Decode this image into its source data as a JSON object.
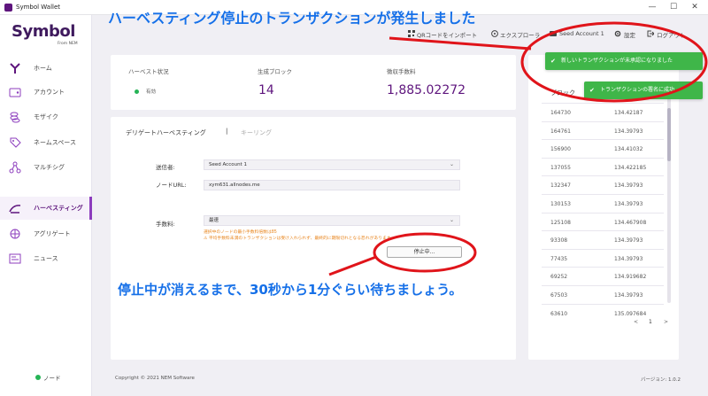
{
  "window": {
    "title": "Symbol Wallet",
    "minimize": "—",
    "maximize": "☐",
    "close": "✕"
  },
  "brand": {
    "logo": "Symbol",
    "sub": "From NEM"
  },
  "nav": [
    {
      "label": "ホーム",
      "icon": "home-icon"
    },
    {
      "label": "アカウント",
      "icon": "account-icon"
    },
    {
      "label": "モザイク",
      "icon": "mosaic-icon"
    },
    {
      "label": "ネームスペース",
      "icon": "namespace-icon"
    },
    {
      "label": "マルチシグ",
      "icon": "multisig-icon"
    },
    {
      "label": "ハーベスティング",
      "icon": "harvesting-icon"
    },
    {
      "label": "アグリゲート",
      "icon": "aggregate-icon"
    },
    {
      "label": "ニュース",
      "icon": "news-icon"
    }
  ],
  "node": {
    "label": "ノード"
  },
  "topbar": {
    "qr": "QRコードをインポート",
    "explorer": "エクスプローラ",
    "account": "Seed Account 1",
    "settings": "設定",
    "logout": "ログアウト"
  },
  "stats": {
    "status_label": "ハーベスト状況",
    "status_value": "有効",
    "blocks_label": "生成ブロック",
    "blocks_value": "14",
    "fees_label": "徴収手数料",
    "fees_value": "1,885.02272"
  },
  "tabs": {
    "delegate": "デリゲートハーベスティング",
    "sep": "|",
    "keyring": "キーリング"
  },
  "form": {
    "sender_label": "送信者:",
    "sender_value": "Seed Account 1",
    "node_label": "ノードURL:",
    "node_value": "xym631.allnodes.me",
    "fee_label": "手数料:",
    "fee_value": "最速",
    "note1": "選択中のノードの最小手数料倍数は85",
    "note2": "⚠ 平均手数料未満のトランザクションは受け入れられず、最終的に期限切れとなる恐れがあります",
    "stop_button": "停止中..."
  },
  "table": {
    "head": "ブロック",
    "rows": [
      [
        "164730",
        "134.42187"
      ],
      [
        "164761",
        "134.39793"
      ],
      [
        "156900",
        "134.41032"
      ],
      [
        "137055",
        "134.422185"
      ],
      [
        "132347",
        "134.39793"
      ],
      [
        "130153",
        "134.39793"
      ],
      [
        "125108",
        "134.467908"
      ],
      [
        "93308",
        "134.39793"
      ],
      [
        "77435",
        "134.39793"
      ],
      [
        "69252",
        "134.919682"
      ],
      [
        "67503",
        "134.39793"
      ],
      [
        "63610",
        "135.097684"
      ]
    ],
    "page": "1",
    "prev": "<",
    "next": ">"
  },
  "toasts": {
    "unconfirmed": "新しいトランザクションが未承認になりました",
    "signed": "トランザクションの署名に成功"
  },
  "footer": {
    "copyright": "Copyright © 2021 NEM Software",
    "version": "バージョン: 1.0.2"
  },
  "annotations": {
    "title": "ハーベスティング停止のトランザクションが発生しました",
    "sub": "停止中が消えるまで、30秒から1分ぐらい待ちましょう。"
  },
  "colors": {
    "brand": "#5e157d",
    "accent": "#8c3dbd",
    "success": "#3fb649",
    "annotation": "#1670e8",
    "annotation_red": "#e0141a"
  }
}
